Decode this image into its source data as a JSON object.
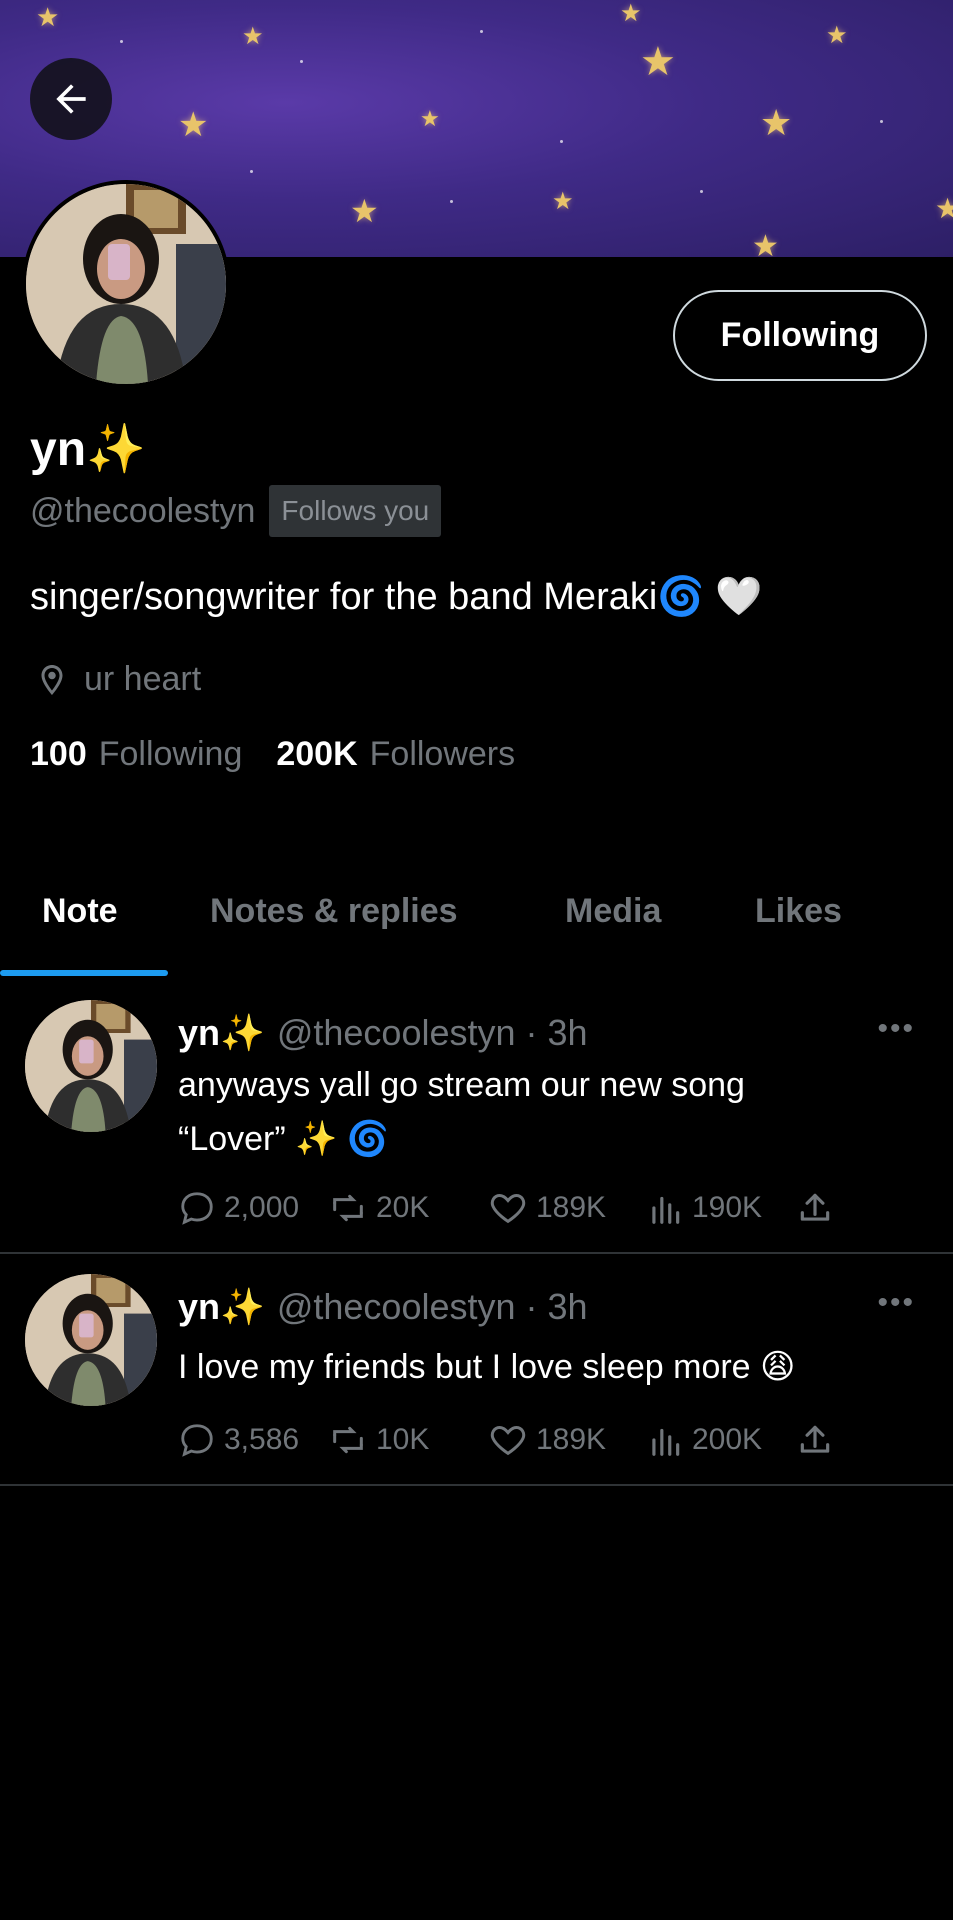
{
  "profile": {
    "name": "yn✨",
    "handle": "@thecoolestyn",
    "follows_you_badge": "Follows you",
    "follow_button_label": "Following",
    "bio": "singer/songwriter for the band Meraki🌀 🤍",
    "location": "ur heart",
    "following_count": "100",
    "following_label": "Following",
    "followers_count": "200K",
    "followers_label": "Followers"
  },
  "tabs": [
    {
      "label": "Note",
      "active": true
    },
    {
      "label": "Notes & replies",
      "active": false
    },
    {
      "label": "Media",
      "active": false
    },
    {
      "label": "Likes",
      "active": false
    }
  ],
  "posts": [
    {
      "name": "yn✨",
      "meta": "@thecoolestyn · 3h",
      "text_line1": "anyways yall go stream our new song",
      "text_line2": "“Lover” ✨ 🌀",
      "replies": "2,000",
      "reposts": "20K",
      "likes": "189K",
      "views": "190K"
    },
    {
      "name": "yn✨",
      "meta": "@thecoolestyn · 3h",
      "text_line1": "I love my friends but I love sleep more 😩",
      "replies": "3,586",
      "reposts": "10K",
      "likes": "189K",
      "views": "200K"
    }
  ],
  "colors": {
    "accent": "#1d9bf0",
    "muted": "#71767b",
    "banner": "#3f2a86"
  }
}
